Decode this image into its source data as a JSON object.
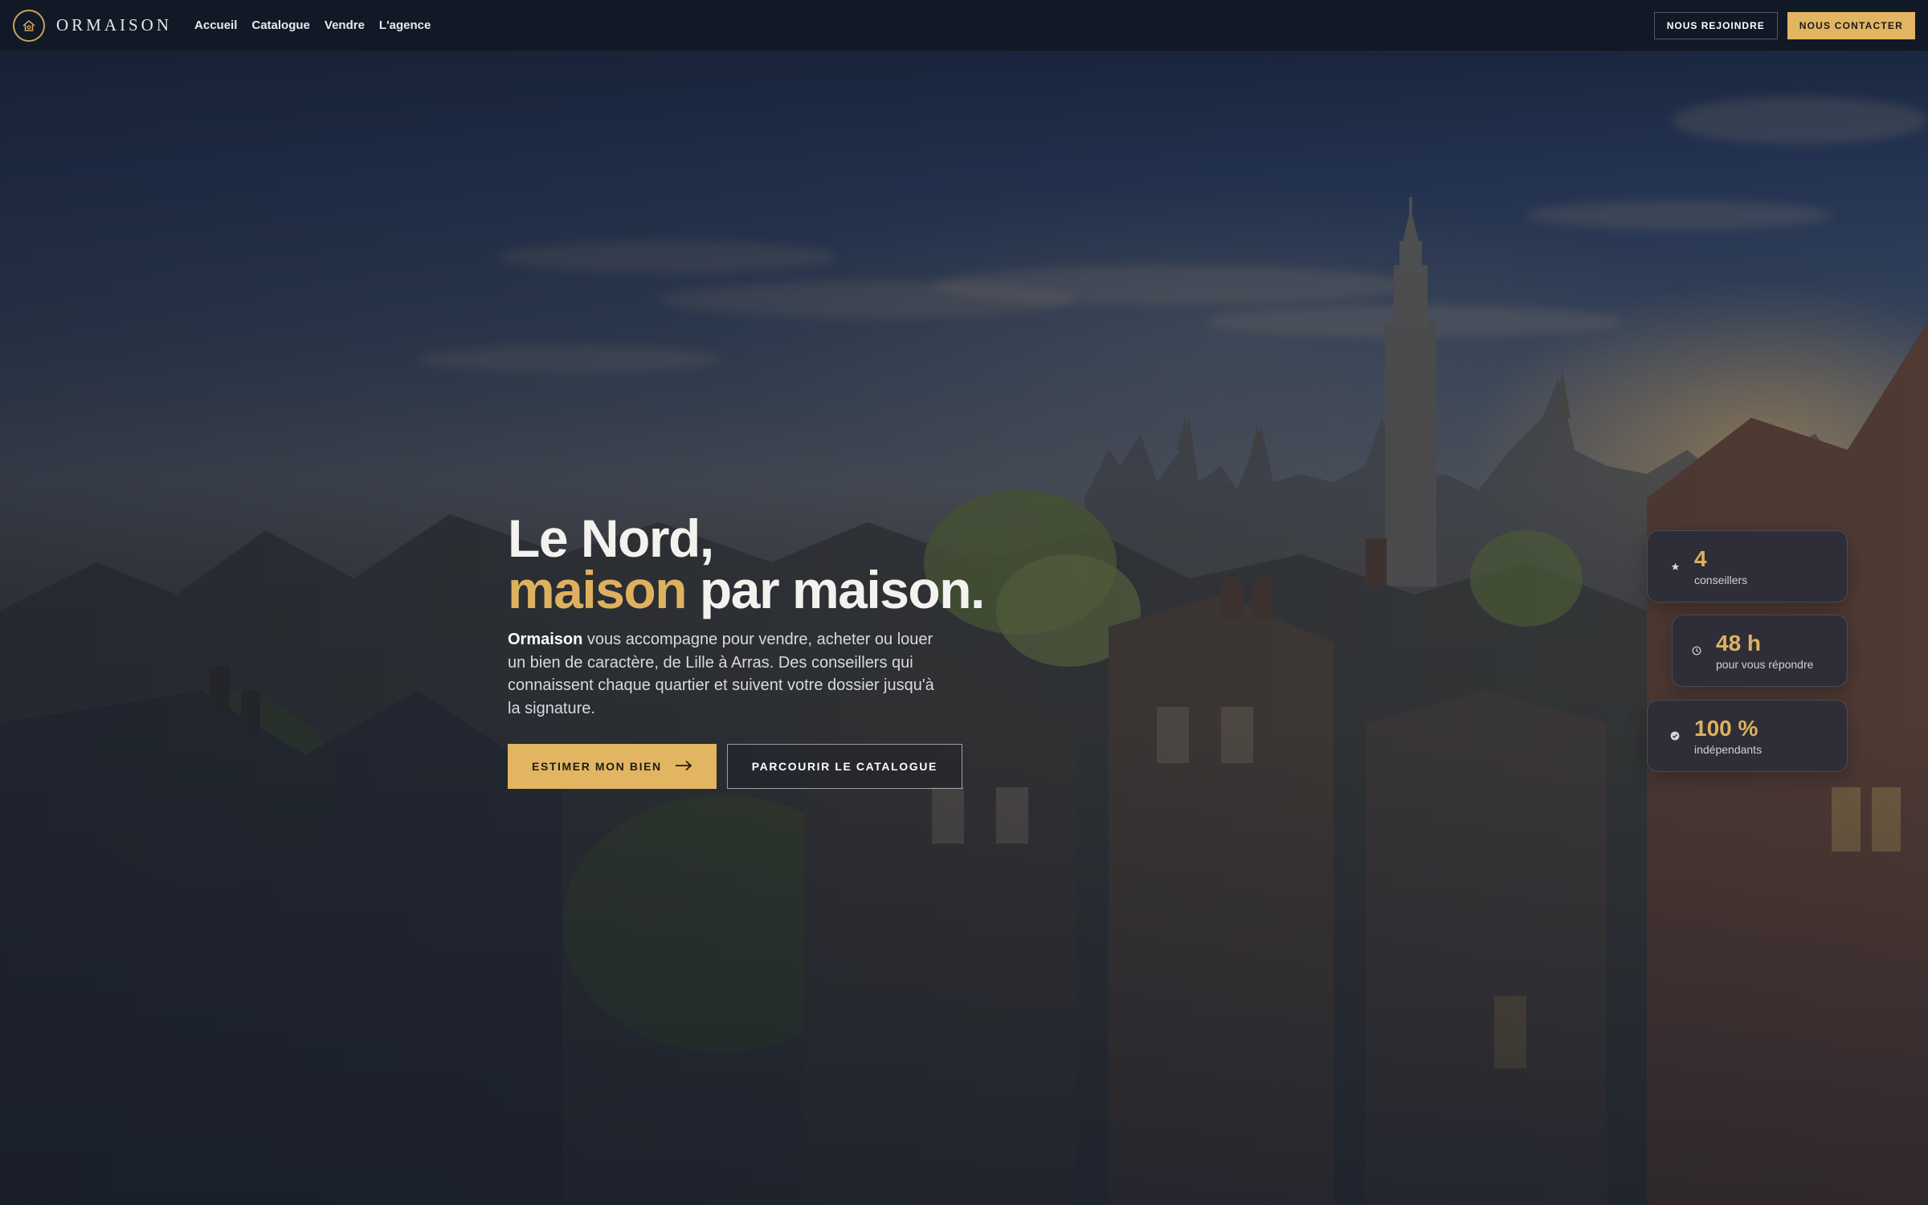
{
  "brand": {
    "name": "ORMAISON",
    "logo_icon": "house-icon",
    "accent_color": "#e1b561"
  },
  "nav": {
    "links": [
      "Accueil",
      "Catalogue",
      "Vendre",
      "L'agence"
    ],
    "join_label": "NOUS REJOINDRE",
    "contact_label": "NOUS CONTACTER"
  },
  "hero": {
    "headline_line1": "Le Nord,",
    "headline_accent": "maison",
    "headline_rest": "par maison.",
    "lead_brand": "Ormaison",
    "lead_text": " vous accompagne pour vendre, acheter ou louer un bien de caractère, de Lille à Arras. Des conseillers qui connaissent chaque quartier et suivent votre dossier jusqu'à la signature.",
    "cta_primary": "ESTIMER MON BIEN",
    "cta_primary_icon": "arrow-right-icon",
    "cta_secondary": "PARCOURIR LE CATALOGUE"
  },
  "stats": [
    {
      "icon": "star-icon",
      "value": "4",
      "label": "conseillers"
    },
    {
      "icon": "clock-icon",
      "value": "48 h",
      "label": "pour vous répondre"
    },
    {
      "icon": "check-circle-icon",
      "value": "100 %",
      "label": "indépendants"
    }
  ]
}
